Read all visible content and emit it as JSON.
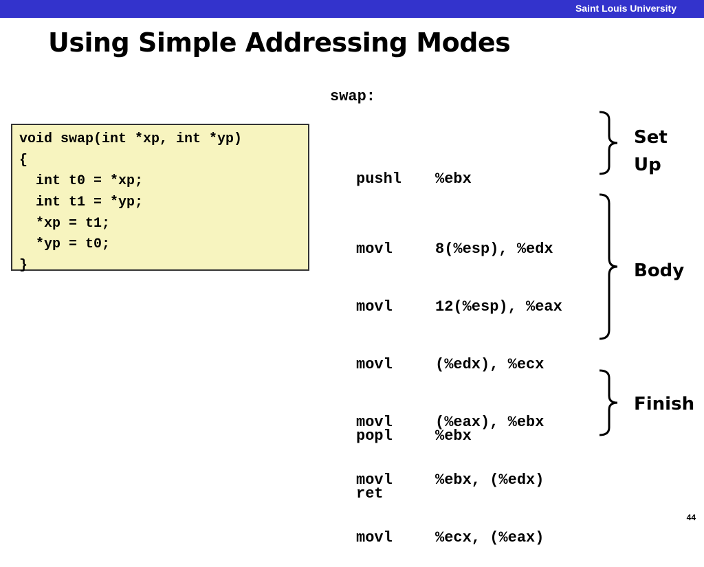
{
  "header": {
    "university": "Saint Louis University",
    "title": "Using Simple Addressing Modes",
    "accent_color": "#3333cc"
  },
  "c_code": {
    "background": "#f7f4bf",
    "lines": [
      "void swap(int *xp, int *yp)",
      "{",
      "  int t0 = *xp;",
      "  int t1 = *yp;",
      "  *xp = t1;",
      "  *yp = t0;",
      "}"
    ]
  },
  "assembly": {
    "label": "swap:",
    "setup": [
      {
        "op": "pushl",
        "args": "%ebx"
      }
    ],
    "body": [
      {
        "op": "movl",
        "args": "8(%esp), %edx"
      },
      {
        "op": "movl",
        "args": "12(%esp), %eax"
      },
      {
        "op": "movl",
        "args": "(%edx), %ecx"
      },
      {
        "op": "movl",
        "args": "(%eax), %ebx"
      },
      {
        "op": "movl",
        "args": "%ebx, (%edx)"
      },
      {
        "op": "movl",
        "args": "%ecx, (%eax)"
      }
    ],
    "finish": [
      {
        "op": "popl",
        "args": "%ebx"
      },
      {
        "op": "ret",
        "args": ""
      }
    ]
  },
  "braces": {
    "setup_label_line1": "Set",
    "setup_label_line2": "Up",
    "body_label": "Body",
    "finish_label": "Finish"
  },
  "footer": {
    "page_number": "44"
  }
}
